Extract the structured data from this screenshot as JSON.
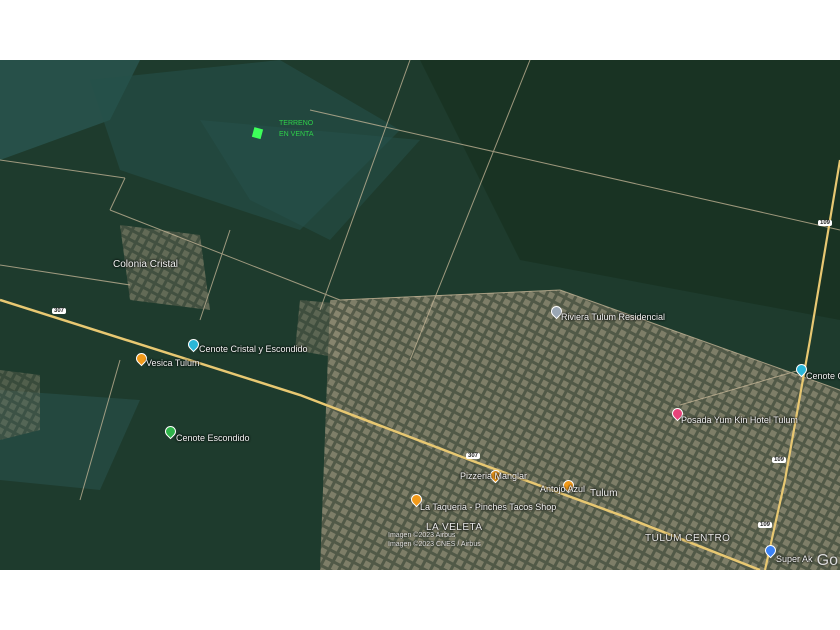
{
  "map": {
    "type": "satellite",
    "parcel_label": [
      "TERRENO",
      "EN VENTA"
    ],
    "parcel_color": "#3dff5a",
    "places": {
      "colonia_cristal": "Colonia Cristal",
      "cenote_cristal_escondido": "Cenote Cristal y Escondido",
      "vesica": "Vesica Tulum",
      "cenote_escondido": "Cenote Escondido",
      "riviera": "Riviera Tulum Residencial",
      "cenote_c": "Cenote C",
      "posada": "Posada Yum Kin Hotel Tulum",
      "pizzeria": "Pizzeria Manglar",
      "antojo": "Antojo Azul",
      "tulum": "Tulum",
      "taqueria": "La Taqueria - Pinches Tacos Shop",
      "la_veleta": "LA VELETA",
      "tulum_centro": "TULUM CENTRO",
      "super_ak": "Super Ak"
    },
    "route_shields": {
      "r307": "307",
      "r109": "109"
    },
    "copyright": [
      "Imagen ©2023 Airbus",
      "Imagen ©2023 CNES / Airbus"
    ],
    "brand": "Go"
  }
}
